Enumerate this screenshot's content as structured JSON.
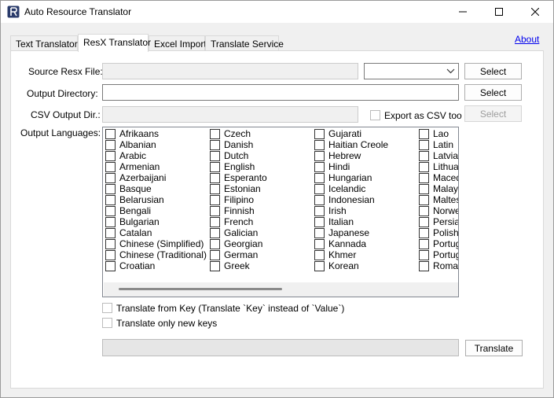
{
  "window": {
    "title": "Auto Resource Translator"
  },
  "tabs": [
    {
      "label": "Text Translator",
      "active": false
    },
    {
      "label": "ResX Translator",
      "active": true
    },
    {
      "label": "Excel Import",
      "active": false
    },
    {
      "label": "Translate Service",
      "active": false
    }
  ],
  "about_link": "About",
  "form": {
    "source_resx_label": "Source Resx File:",
    "source_resx_value": "",
    "source_combo_value": "",
    "source_select_label": "Select",
    "output_dir_label": "Output Directory:",
    "output_dir_value": "",
    "output_select_label": "Select",
    "csv_output_label": "CSV Output Dir.:",
    "csv_output_value": "",
    "export_csv_label": "Export as CSV too",
    "csv_select_label": "Select",
    "output_languages_label": "Output Languages:"
  },
  "languages": {
    "col1": [
      "Afrikaans",
      "Albanian",
      "Arabic",
      "Armenian",
      "Azerbaijani",
      "Basque",
      "Belarusian",
      "Bengali",
      "Bulgarian",
      "Catalan",
      "Chinese (Simplified)",
      "Chinese (Traditional)",
      "Croatian"
    ],
    "col2": [
      "Czech",
      "Danish",
      "Dutch",
      "English",
      "Esperanto",
      "Estonian",
      "Filipino",
      "Finnish",
      "French",
      "Galician",
      "Georgian",
      "German",
      "Greek"
    ],
    "col3": [
      "Gujarati",
      "Haitian Creole",
      "Hebrew",
      "Hindi",
      "Hungarian",
      "Icelandic",
      "Indonesian",
      "Irish",
      "Italian",
      "Japanese",
      "Kannada",
      "Khmer",
      "Korean"
    ],
    "col4": [
      "Lao",
      "Latin",
      "Latvian",
      "Lithuanian",
      "Macedonian",
      "Malay",
      "Maltese",
      "Norwegian",
      "Persian",
      "Polish",
      "Portuguese",
      "Portuguese",
      "Romanian"
    ]
  },
  "options": {
    "translate_from_key": "Translate from Key (Translate `Key` instead of `Value`)",
    "translate_only_new": "Translate only new keys"
  },
  "translate_button": "Translate",
  "progress": 0
}
